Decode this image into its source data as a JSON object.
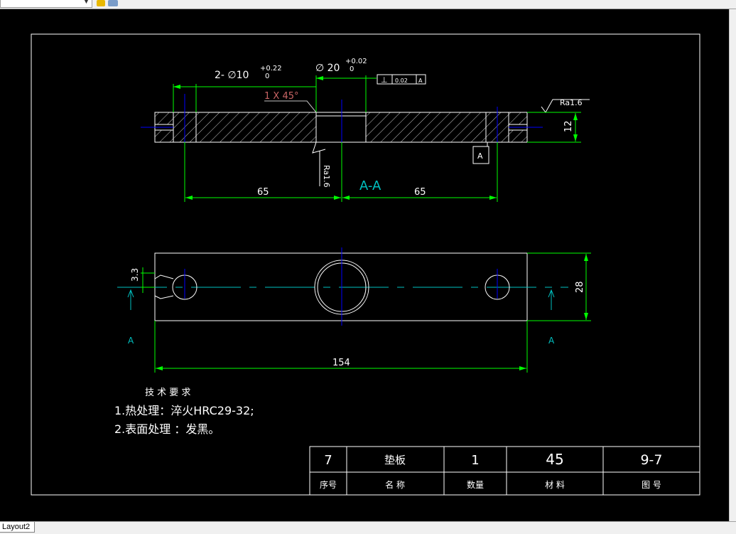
{
  "app": {
    "layout_tab": "Layout2",
    "colors": {
      "background": "#000000",
      "geometry": "#ffffff",
      "dimension": "#00ff00",
      "centerline": "#0000ff",
      "section_label": "#00c0c0",
      "leader": "#c0c0c0"
    }
  },
  "drawing": {
    "section_view": {
      "hole_small_label": "2- ∅10",
      "hole_small_tol_upper": "+0.22",
      "hole_small_tol_lower": "0",
      "hole_big_label": "∅ 20",
      "hole_big_tol_upper": "+0.02",
      "hole_big_tol_lower": "0",
      "tolerance_frame": {
        "symbol": "⊥",
        "value": "0.02",
        "datum": "A"
      },
      "chamfer_label": "1 X 45°",
      "ra_right": "Ra1.6",
      "ra_bottom": "Ra1.6",
      "datum_box": "A",
      "section_title": "A-A",
      "dim_left": "65",
      "dim_right": "65",
      "dim_thickness": "12"
    },
    "plan_view": {
      "dim_width": "28",
      "dim_length": "154",
      "dim_offset": "3.3",
      "section_mark_left": "A",
      "section_mark_right": "A"
    },
    "notes": {
      "title": "技 术 要 求",
      "lines": [
        "1.热处理：淬火HRC29-32;",
        "2.表面处理 ：发黑。"
      ]
    },
    "title_block": {
      "values": [
        "7",
        "垫板",
        "1",
        "45",
        "9-7"
      ],
      "headers": [
        "序号",
        "名 称",
        "数量",
        "材 料",
        "图 号"
      ]
    }
  }
}
